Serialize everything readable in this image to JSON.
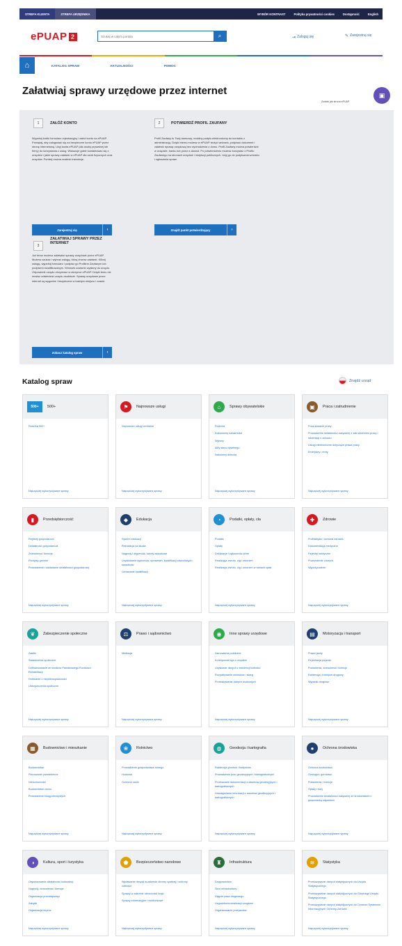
{
  "topbar": {
    "tabs": [
      "STREFA KLIENTA",
      "STREFA URZĘDNIKA"
    ],
    "links": [
      "WYBÓR KONTRAST",
      "Polityka prywatności cookies",
      "Dostępność",
      "English"
    ]
  },
  "header": {
    "logo": "ePUAP",
    "logo_badge": "2",
    "search_placeholder": "Szukaj w całym portalu",
    "login": "Zaloguj się",
    "register": "Zarejestruj się"
  },
  "colors": {
    "accent": "#1f6fbf",
    "brand": "#d7191f",
    "dark": "#1f2547",
    "colorline": [
      "#d7191f",
      "#f2a400",
      "#2eaa4a",
      "#1f6fbf",
      "#6350b8"
    ]
  },
  "nav": {
    "items": [
      "KATALOG SPRAW",
      "AKTUALNOŚCI",
      "POMOC"
    ]
  },
  "page_title": "Załatwiaj sprawy urzędowe przez internet",
  "promo": "Zostań jak strona ePUAP",
  "steps": [
    {
      "num": "1",
      "title": "ZAŁÓŻ KONTO",
      "body": "Wypełnij krótki formularz rejestracyjny i załóż konto na ePUAP. Pamiętaj, aby zalogować się na bezpieczne konto ePUAP przez stronę internetową. Użyj konta ePUAP (dla osoby prywatnej lub firmy) do korzystania z usług. Wskazuje gdzie kontaktować się z urzędem i jakie sprawy załatwić w ePUAP dla osób fizycznych oraz urzędów. Poniżej można znaleźć instrukcje.",
      "button": "Zarejestruj się"
    },
    {
      "num": "2",
      "title": "POTWIERDŹ PROFIL ZAUFANY",
      "body": "Profil Zaufany to Twój darmowy, mobilny podpis elektroniczny do kontaktu z administracją. Dzięki niemu możesz w ePUAP złożyć wniosek, podpisać dokument i załatwić sprawę urzędową bez wychodzenia z domu. Profil Zaufany można potwierdzić w urzędzie, banku lub przez e-dowód. Po potwierdzeniu możesz korzystać z Profilu Zaufanego na stronach urzędów i instytucji publicznych. Użyj go do podpisania wniosku i zgłoszenia spraw.",
      "button": "Znajdź punkt potwierdzający"
    },
    {
      "num": "3",
      "title": "ZAŁATWIAJ SPRAWY PRZEZ INTERNET",
      "body": "Już teraz możesz załatwiać sprawy urzędowe przez ePUAP. Możesz szukać i wybrać usługę, którą chcesz załatwić. Kliknij usługę, wypełnij formularz i podpisz go Profilem Zaufanym lub podpisem kwalifikowanym. Wniosek zostanie wysłany do urzędu. Odpowiedź urzędu otrzymasz w skrzynce ePUAP. Dzięki temu nie musisz odwiedzać urzędu osobiście. Sprawy urzędowe przez internet są wygodne i bezpieczne w każdym miejscu i czasie.",
      "button": "Zobacz katalog spraw"
    }
  ],
  "catalog": {
    "title": "Katalog spraw",
    "find_office": "Znajdź urząd",
    "more": "Najczęściej wykorzystywane sprawy",
    "cards": [
      {
        "name": "500+",
        "icon": "500-plus-icon",
        "glyph": "500+",
        "color": "#1f8fd6",
        "links": [
          "Rodzina 500+"
        ]
      },
      {
        "name": "Najnowsze usługi",
        "icon": "flag-icon",
        "glyph": "⚑",
        "color": "#d7191f",
        "links": [
          "Najnowsze usługi centralne"
        ]
      },
      {
        "name": "Sprawy obywatelskie",
        "icon": "house-icon",
        "glyph": "⌂",
        "color": "#2eaa4a",
        "links": [
          "Rodzina",
          "Dokumenty tożsamości",
          "Wybory",
          "Akty stanu cywilnego",
          "Narodziny dziecka"
        ]
      },
      {
        "name": "Praca i zatrudnienie",
        "icon": "briefcase-icon",
        "glyph": "▣",
        "color": "#8a5a2b",
        "links": [
          "Poszukiwanie pracy",
          "Prowadzenie działalności związanej z zatrudnieniem pracy i informacji o zdrowiu",
          "Usługi elektroniczne dotyczące prawa pracy",
          "Emerytury i renty"
        ]
      },
      {
        "name": "Przedsiębiorczość",
        "icon": "chart-icon",
        "glyph": "▮",
        "color": "#d7191f",
        "links": [
          "Rejestry gospodarcze",
          "Działalność gospodarcza",
          "Zezwolenia i licencje",
          "Przepisy gminne",
          "Prowadzenie i zakładanie działalności gospodarczej"
        ]
      },
      {
        "name": "Edukacja",
        "icon": "graduation-icon",
        "glyph": "◆",
        "color": "#1f3f6f",
        "links": [
          "System edukacji",
          "Rekrutacja na studia",
          "Nagrody i stypendia, szkoły zawodowe",
          "Uzyskiwanie dyplomów, uprawnień, kwalifikacji zawodowych, świadectw",
          "Uznawanie kwalifikacji"
        ]
      },
      {
        "name": "Podatki, opłaty, cła",
        "icon": "pie-chart-icon",
        "glyph": "◔",
        "color": "#1f8fd6",
        "links": [
          "Podatki",
          "Opłaty",
          "Deklaracje i zgłoszenia celne",
          "Realizacja zwrotu, ulg i umorzeń",
          "Realizacja zwrotu, ulg i umorzeń w ramach opłat"
        ]
      },
      {
        "name": "Zdrowie",
        "icon": "medical-cross-icon",
        "glyph": "✚",
        "color": "#d7191f",
        "links": [
          "Profilaktyka i ochrona zdrowia",
          "Dokumentacja medyczna",
          "Rejestry medyczne",
          "Przewożenie chorych",
          "Wypożyczalnie"
        ]
      },
      {
        "name": "Zabezpieczenie społeczne",
        "icon": "hands-icon",
        "glyph": "❦",
        "color": "#1aa29a",
        "links": [
          "Zasiłki",
          "Świadczenia społeczne",
          "Dofinansowanie ze środków Państwowego Funduszu Rehabilitacji",
          "Orzekanie o niepełnosprawności",
          "Ubezpieczenia społeczne"
        ]
      },
      {
        "name": "Prawo i sądownictwo",
        "icon": "scales-icon",
        "glyph": "⚖",
        "color": "#1f3f6f",
        "links": [
          "Mediacja"
        ]
      },
      {
        "name": "Inne sprawy urzędowe",
        "icon": "bag-icon",
        "glyph": "◉",
        "color": "#2eaa4a",
        "links": [
          "Zamówienia publiczne",
          "Korespondencja z urzędem",
          "Uzyskanie danych z ewidencji ludności",
          "Rozpatrywanie wniosków i skarg",
          "Przekazywanie danych osobowych"
        ]
      },
      {
        "name": "Motoryzacja i transport",
        "icon": "printer-icon",
        "glyph": "▤",
        "color": "#1f3f6f",
        "links": [
          "Prawo jazdy",
          "Rejestracja pojazdu",
          "Pozwolenia, zezwolenia i licencje",
          "Ewidencja i transport drogowy",
          "Wypadki drogowe"
        ]
      },
      {
        "name": "Budownictwo i mieszkanie",
        "icon": "building-icon",
        "glyph": "▦",
        "color": "#8a5a2b",
        "links": [
          "Budownictwo",
          "Planowanie przestrzenne",
          "Nieruchomości",
          "Budownictwo domu",
          "Prowadzenie ksiąg wieczystych"
        ]
      },
      {
        "name": "Rolnictwo",
        "icon": "wheat-icon",
        "glyph": "❀",
        "color": "#1f8fd6",
        "links": [
          "Prowadzenie gospodarstwa rolnego",
          "Hodowla",
          "Ochrona roślin"
        ]
      },
      {
        "name": "Geodezja i kartografia",
        "icon": "globe-icon",
        "glyph": "◍",
        "color": "#1aa29a",
        "links": [
          "Ewidencja gruntów i budynków",
          "Prowadzenie prac geodezyjnych i kartograficznych",
          "Przekazanie dokumentacji z zasobów geodezyjnych i kartograficznych",
          "Udostępnianie informacji z zasobów geodezyjnych i kartograficznych"
        ]
      },
      {
        "name": "Ochrona środowiska",
        "icon": "leaf-icon",
        "glyph": "●",
        "color": "#1f3f6f",
        "links": [
          "Ochrona środowiska",
          "Geologia i górnictwo",
          "Pozwolenia i licencje",
          "Opłaty i kary",
          "Prowadzenie działalności związanej ze środowiskiem i gospodarką odpadami"
        ]
      },
      {
        "name": "Kultura, sport i turystyka",
        "icon": "theater-icon",
        "glyph": "◑",
        "color": "#6350b8",
        "links": [
          "Organizowanie działalności kulturalnej",
          "Nagrody, zezwolenia i licencje",
          "Organizacja przedsięwzięć",
          "Zabytki",
          "Organizacja imprez"
        ]
      },
      {
        "name": "Bezpieczeństwo narodowe",
        "icon": "shield-icon",
        "glyph": "⬟",
        "color": "#e0a000",
        "links": [
          "Wydawanie decyzji w zakresie obrony cywilnej i ochrony ludności",
          "Sprawy w zakresie obronności kraju",
          "Sprawy informacyjne i meldunkowe"
        ]
      },
      {
        "name": "Infrastruktura",
        "icon": "tower-icon",
        "glyph": "♜",
        "color": "#2e6b3a",
        "links": [
          "Drogownictwo",
          "Sieci infrastruktury",
          "Zajęcie pasa drogowego",
          "Uzgodnienia lokalizacji urządzeń",
          "Organizowanie przejazdów"
        ]
      },
      {
        "name": "Statystyka",
        "icon": "statistics-icon",
        "glyph": "≋",
        "color": "#e0a000",
        "links": [
          "Przekazywanie danych statystycznych do Urzędu Statystycznego",
          "Przekazywanie danych statystycznych do Głównego Urzędu Statystycznego",
          "Przekazywanie danych statystycznych do Centrum Systemów Informacyjnych Ochrony Zdrowia"
        ]
      }
    ]
  }
}
